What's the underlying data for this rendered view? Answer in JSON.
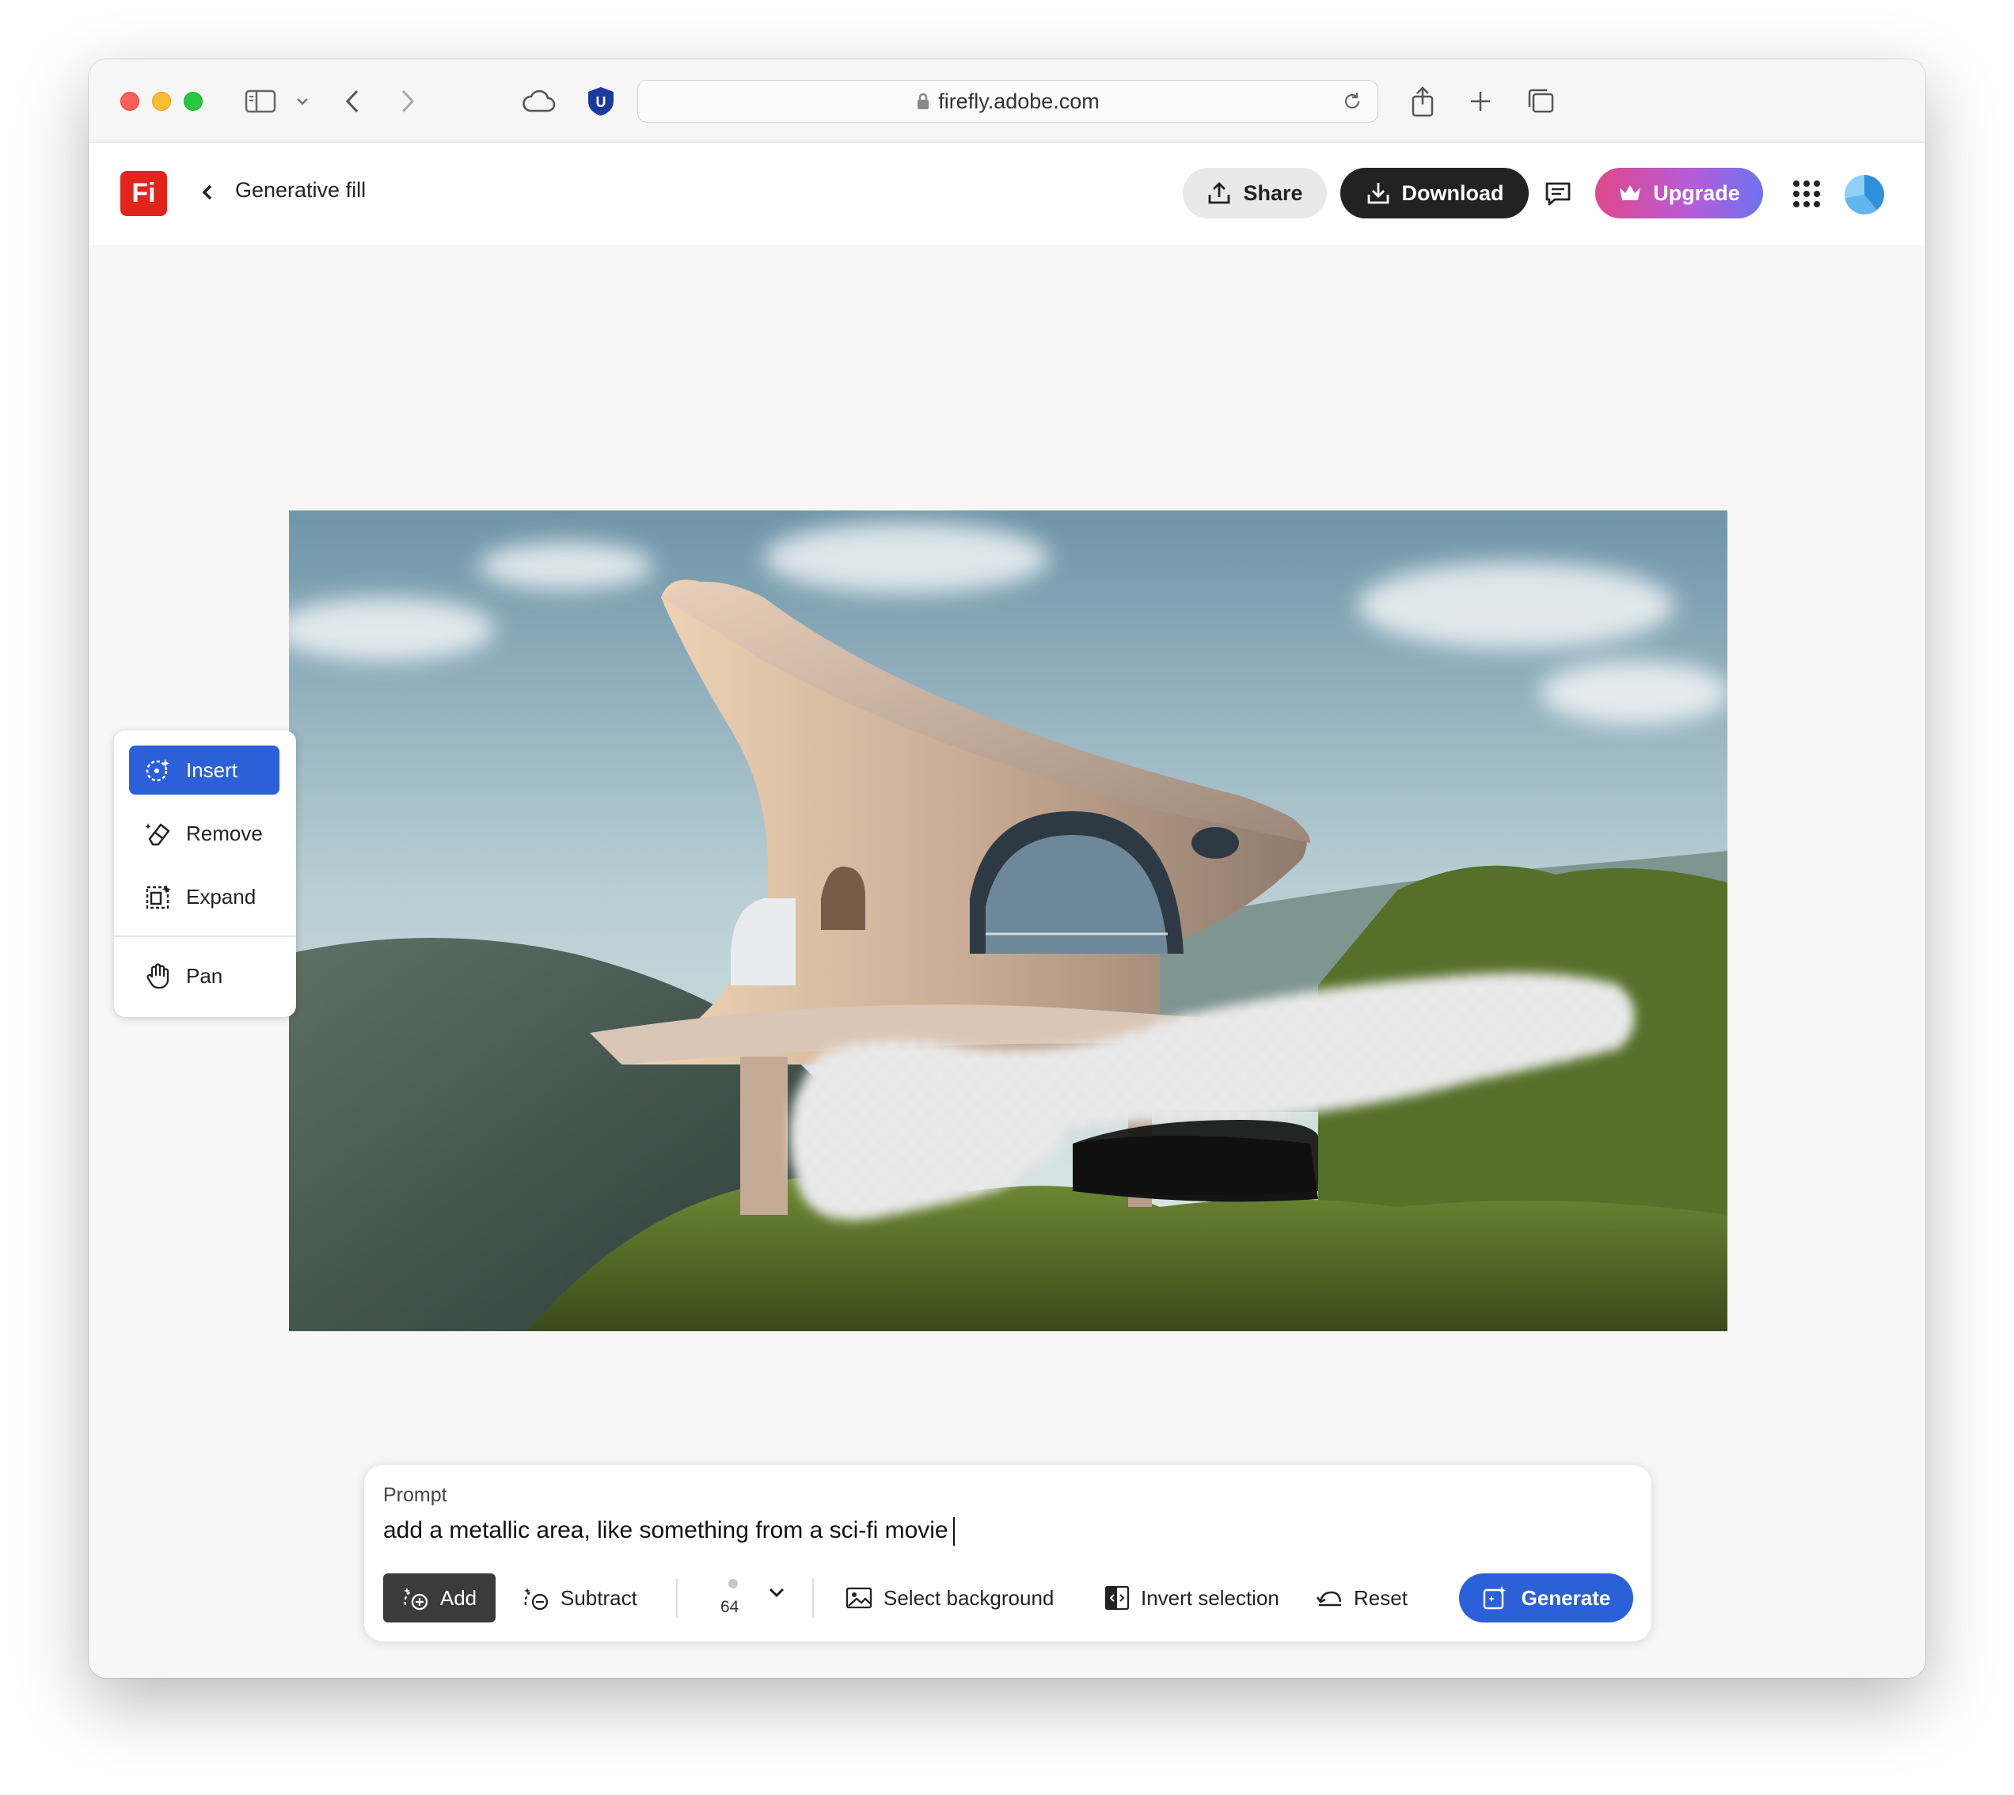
{
  "browser": {
    "url": "firefly.adobe.com",
    "extension_badge": "U"
  },
  "header": {
    "logo_text": "Fi",
    "title": "Generative fill",
    "share_label": "Share",
    "download_label": "Download",
    "upgrade_label": "Upgrade"
  },
  "tools": {
    "items": [
      {
        "label": "Insert",
        "icon": "insert-icon",
        "active": true
      },
      {
        "label": "Remove",
        "icon": "eraser-icon",
        "active": false
      },
      {
        "label": "Expand",
        "icon": "expand-icon",
        "active": false
      },
      {
        "label": "Pan",
        "icon": "hand-icon",
        "active": false
      }
    ]
  },
  "prompt": {
    "label": "Prompt",
    "value": "add a metallic area, like something from a sci-fi movie",
    "add_label": "Add",
    "subtract_label": "Subtract",
    "brush_size": "64",
    "select_background_label": "Select background",
    "invert_selection_label": "Invert selection",
    "reset_label": "Reset",
    "generate_label": "Generate"
  },
  "colors": {
    "accent_blue": "#2c60d8",
    "logo_red": "#e1251b",
    "download_dark": "#222222"
  }
}
